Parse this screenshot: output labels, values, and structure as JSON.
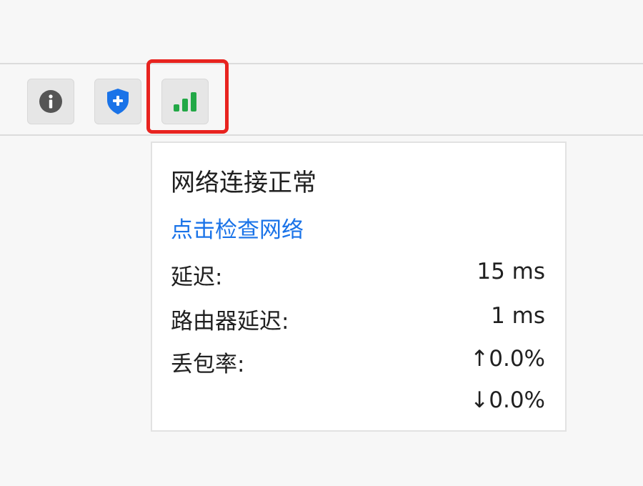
{
  "toolbar": {
    "buttons": [
      {
        "id": "info",
        "icon": "info-circle-icon"
      },
      {
        "id": "shield",
        "icon": "shield-plus-icon",
        "color": "#1a73e8"
      },
      {
        "id": "network",
        "icon": "signal-bars-icon",
        "color": "#22a846",
        "highlighted": true
      }
    ],
    "highlight_color": "#e8231f"
  },
  "popup": {
    "title": "网络连接正常",
    "check_link": "点击检查网络",
    "latency": {
      "label": "延迟:",
      "value": "15 ms"
    },
    "router_latency": {
      "label": "路由器延迟:",
      "value": "1 ms"
    },
    "packet_loss": {
      "label": "丢包率:",
      "up": "↑0.0%",
      "down": "↓0.0%"
    }
  },
  "colors": {
    "link": "#1a73e8",
    "signal": "#22a846",
    "shield": "#1a73e8"
  }
}
